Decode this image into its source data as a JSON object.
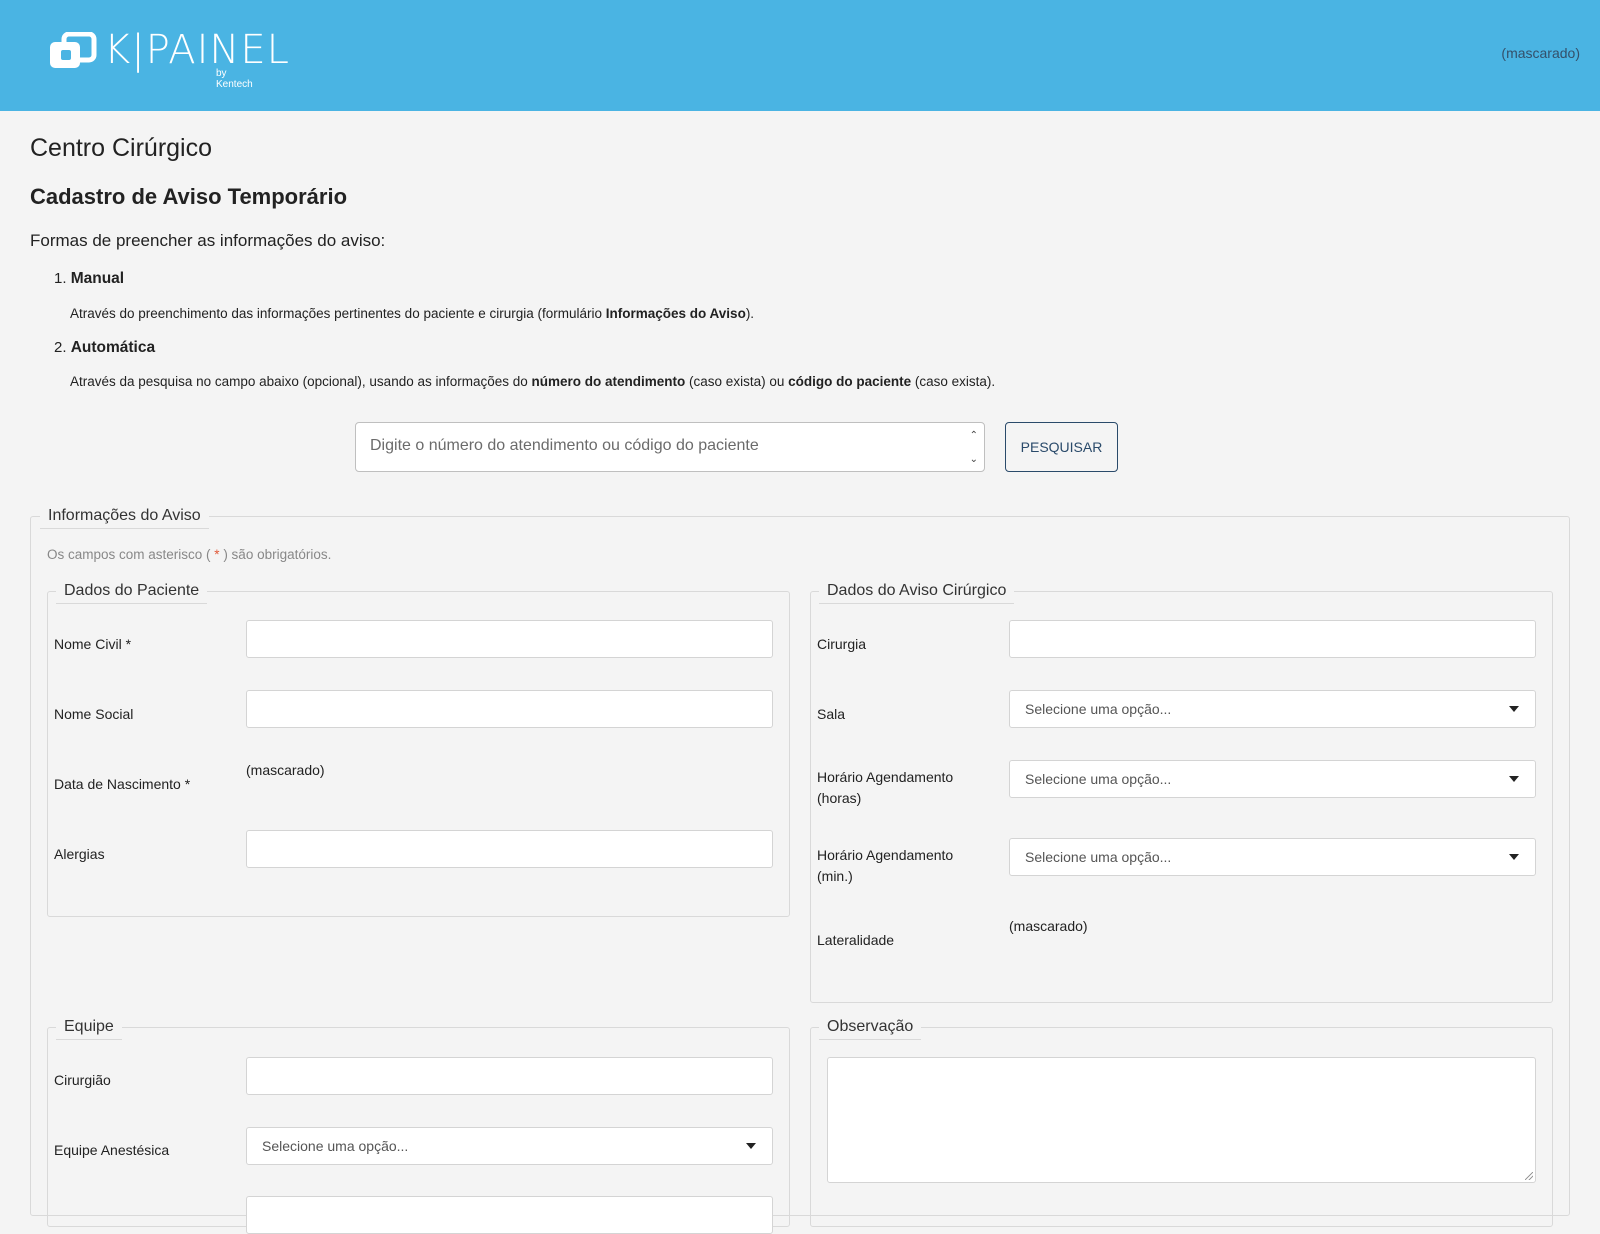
{
  "header": {
    "logo_text": "K|PAINEL",
    "logo_sub": "by Kentech",
    "user": "(mascarado)"
  },
  "page": {
    "title": "Centro Cirúrgico",
    "subtitle": "Cadastro de Aviso Temporário",
    "intro": "Formas de preencher as informações do aviso:"
  },
  "steps": [
    {
      "num": "1.",
      "title": "Manual",
      "desc_pre": "Através do preenchimento das informações pertinentes do paciente e cirurgia (formulário ",
      "desc_bold": "Informações do Aviso",
      "desc_post": ")."
    },
    {
      "num": "2.",
      "title": "Automática",
      "desc_pre": "Através da pesquisa no campo abaixo (opcional), usando as informações do ",
      "desc_bold1": "número do atendimento",
      "desc_mid": " (caso exista) ou ",
      "desc_bold2": "código do paciente",
      "desc_post": " (caso exista)."
    }
  ],
  "search": {
    "placeholder": "Digite o número do atendimento ou código do paciente",
    "value": "",
    "button_label": "PESQUISAR"
  },
  "form": {
    "legend": "Informações do Aviso",
    "required_pre": "Os campos com asterisco ( ",
    "required_star": "*",
    "required_post": " ) são obrigatórios.",
    "patient": {
      "legend": "Dados do Paciente",
      "nome_civil_label": "Nome Civil *",
      "nome_civil_value": "",
      "nome_social_label": "Nome Social",
      "nome_social_value": "",
      "nascimento_label": "Data de Nascimento *",
      "nascimento_value": "(mascarado)",
      "alergias_label": "Alergias",
      "alergias_value": ""
    },
    "surgery": {
      "legend": "Dados do Aviso Cirúrgico",
      "cirurgia_label": "Cirurgia",
      "cirurgia_value": "",
      "sala_label": "Sala",
      "sala_value": "Selecione uma opção...",
      "horas_label_1": "Horário Agendamento",
      "horas_label_2": "(horas)",
      "horas_value": "Selecione uma opção...",
      "min_label_1": "Horário Agendamento",
      "min_label_2": "(min.)",
      "min_value": "Selecione uma opção...",
      "lateralidade_label": "Lateralidade",
      "lateralidade_value": "(mascarado)"
    },
    "team": {
      "legend": "Equipe",
      "cirurgiao_label": "Cirurgião",
      "cirurgiao_value": "",
      "anestesica_label": "Equipe Anestésica",
      "anestesica_value": "Selecione uma opção..."
    },
    "obs": {
      "legend": "Observação",
      "value": ""
    }
  },
  "icons": {
    "logo": "kpainel-logo-icon",
    "spin_up": "chevron-up-icon",
    "spin_down": "chevron-down-icon",
    "caret": "caret-down-icon"
  },
  "colors": {
    "header_bg": "#4ab4e3",
    "page_bg": "#f4f4f4",
    "button_border": "#2a4a6a",
    "required_star": "#e05a3a"
  }
}
